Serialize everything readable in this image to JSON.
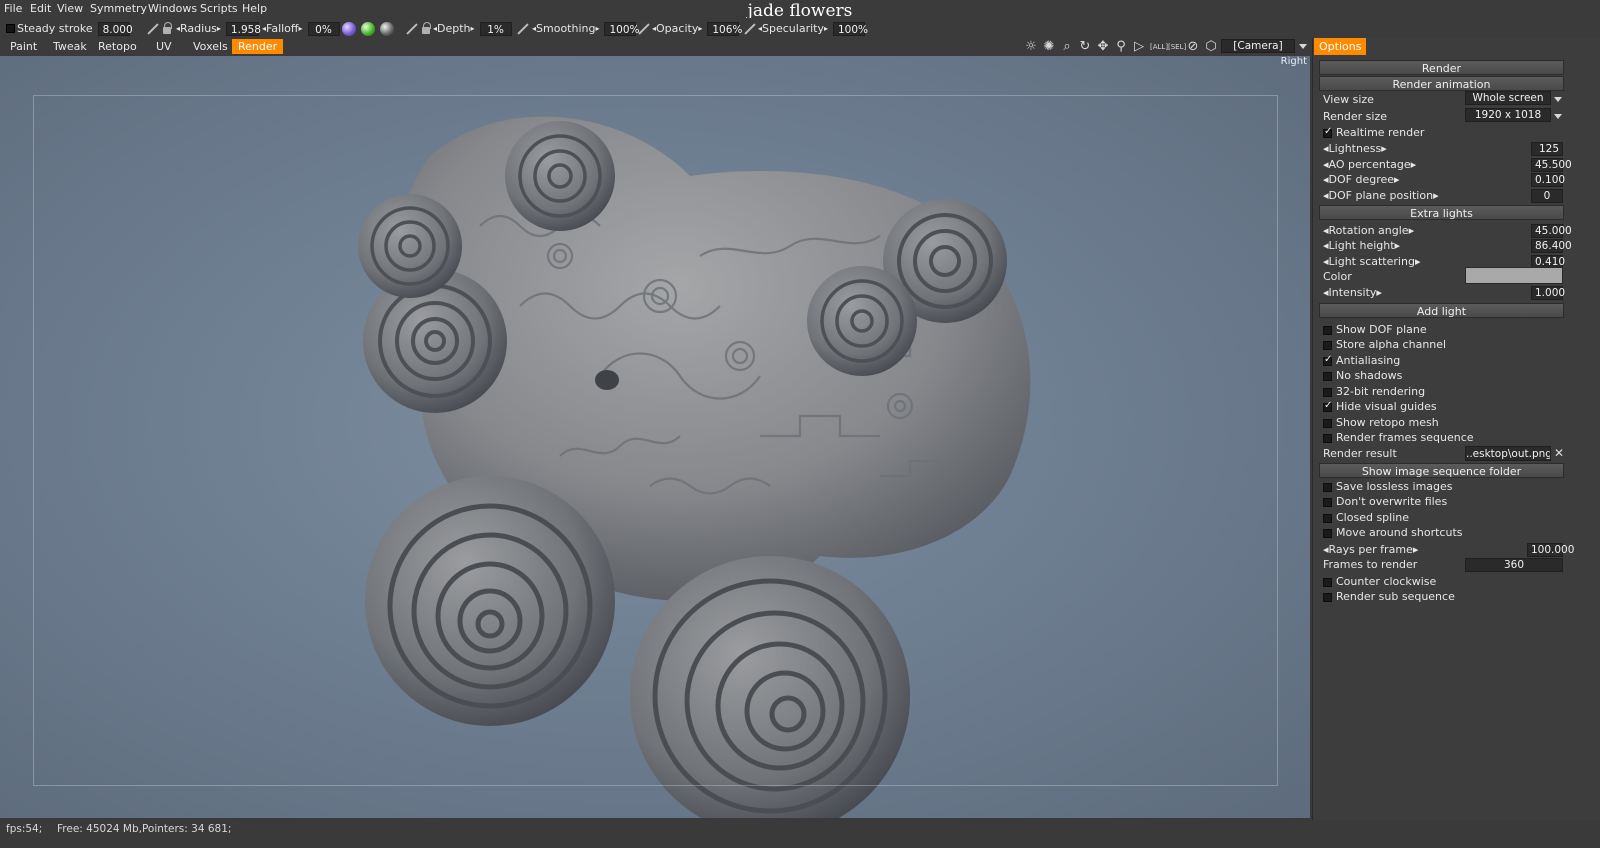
{
  "menu": [
    "File",
    "Edit",
    "View",
    "Symmetry",
    "Windows",
    "Scripts",
    "Help"
  ],
  "document_title": "jade flowers",
  "toolbar": {
    "steady_stroke": {
      "label": "Steady stroke",
      "value": "8.000"
    },
    "radius": {
      "label": "Radius",
      "value": "1.958"
    },
    "falloff": {
      "label": "Falloff",
      "value": "0%"
    },
    "depth": {
      "label": "Depth",
      "value": "1%"
    },
    "smoothing": {
      "label": "Smoothing",
      "value": "100%"
    },
    "opacity": {
      "label": "Opacity",
      "value": "106%"
    },
    "specularity": {
      "label": "Specularity",
      "value": "100%"
    }
  },
  "rooms": [
    "Paint",
    "Tweak",
    "Retopo",
    "UV",
    "Voxels",
    "Render"
  ],
  "active_room": "Render",
  "nav_icons": [
    "sun-icon",
    "light-bulb-icon",
    "pick-icon",
    "rotate-icon",
    "move-icon",
    "zoom-icon",
    "play-icon",
    "fit-all-icon",
    "fit-selection-icon",
    "disable-icon",
    "cube-icon"
  ],
  "camera": "[Camera]",
  "viewport": {
    "view_label": "Right"
  },
  "panel": {
    "tab": "Options",
    "render_button": "Render",
    "render_animation_button": "Render animation",
    "view_size": {
      "label": "View size",
      "value": "Whole screen"
    },
    "render_size": {
      "label": "Render size",
      "value": "1920  x  1018"
    },
    "realtime_render": {
      "label": "Realtime render",
      "checked": true
    },
    "lightness": {
      "label": "Lightness",
      "value": "125"
    },
    "ao_percentage": {
      "label": "AO percentage",
      "value": "45.500"
    },
    "dof_degree": {
      "label": "DOF degree",
      "value": "0.100"
    },
    "dof_plane_position": {
      "label": "DOF plane position",
      "value": "0"
    },
    "extra_lights_button": "Extra lights",
    "rotation_angle": {
      "label": "Rotation angle",
      "value": "45.000"
    },
    "light_height": {
      "label": "Light height",
      "value": "86.400"
    },
    "light_scattering": {
      "label": "Light scattering",
      "value": "0.410"
    },
    "color": {
      "label": "Color",
      "value": "#a9a9a9"
    },
    "intensity": {
      "label": "Intensity",
      "value": "1.000"
    },
    "add_light_button": "Add light",
    "checks1": [
      {
        "label": "Show DOF plane",
        "checked": false
      },
      {
        "label": "Store alpha channel",
        "checked": false
      },
      {
        "label": "Antialiasing",
        "checked": true
      },
      {
        "label": "No shadows",
        "checked": false
      },
      {
        "label": "32-bit rendering",
        "checked": false
      },
      {
        "label": "Hide visual guides",
        "checked": true
      },
      {
        "label": "Show retopo mesh",
        "checked": false
      },
      {
        "label": "Render frames sequence",
        "checked": false
      }
    ],
    "render_result": {
      "label": "Render result",
      "value": "..esktop\\out.png"
    },
    "show_folder_button": "Show image sequence folder",
    "checks2": [
      {
        "label": "Save lossless images",
        "checked": false
      },
      {
        "label": "Don't overwrite files",
        "checked": false
      },
      {
        "label": "Closed spline",
        "checked": false
      },
      {
        "label": "Move around shortcuts",
        "checked": false
      }
    ],
    "rays_per_frame": {
      "label": "Rays per frame",
      "value": "100.000"
    },
    "frames_to_render": {
      "label": "Frames to render",
      "value": "360"
    },
    "checks3": [
      {
        "label": "Counter clockwise",
        "checked": false
      },
      {
        "label": "Render sub sequence",
        "checked": false
      }
    ]
  },
  "status": {
    "fps": "fps:54;",
    "memory": "Free: 45024 Mb,Pointers: 34 681;"
  }
}
